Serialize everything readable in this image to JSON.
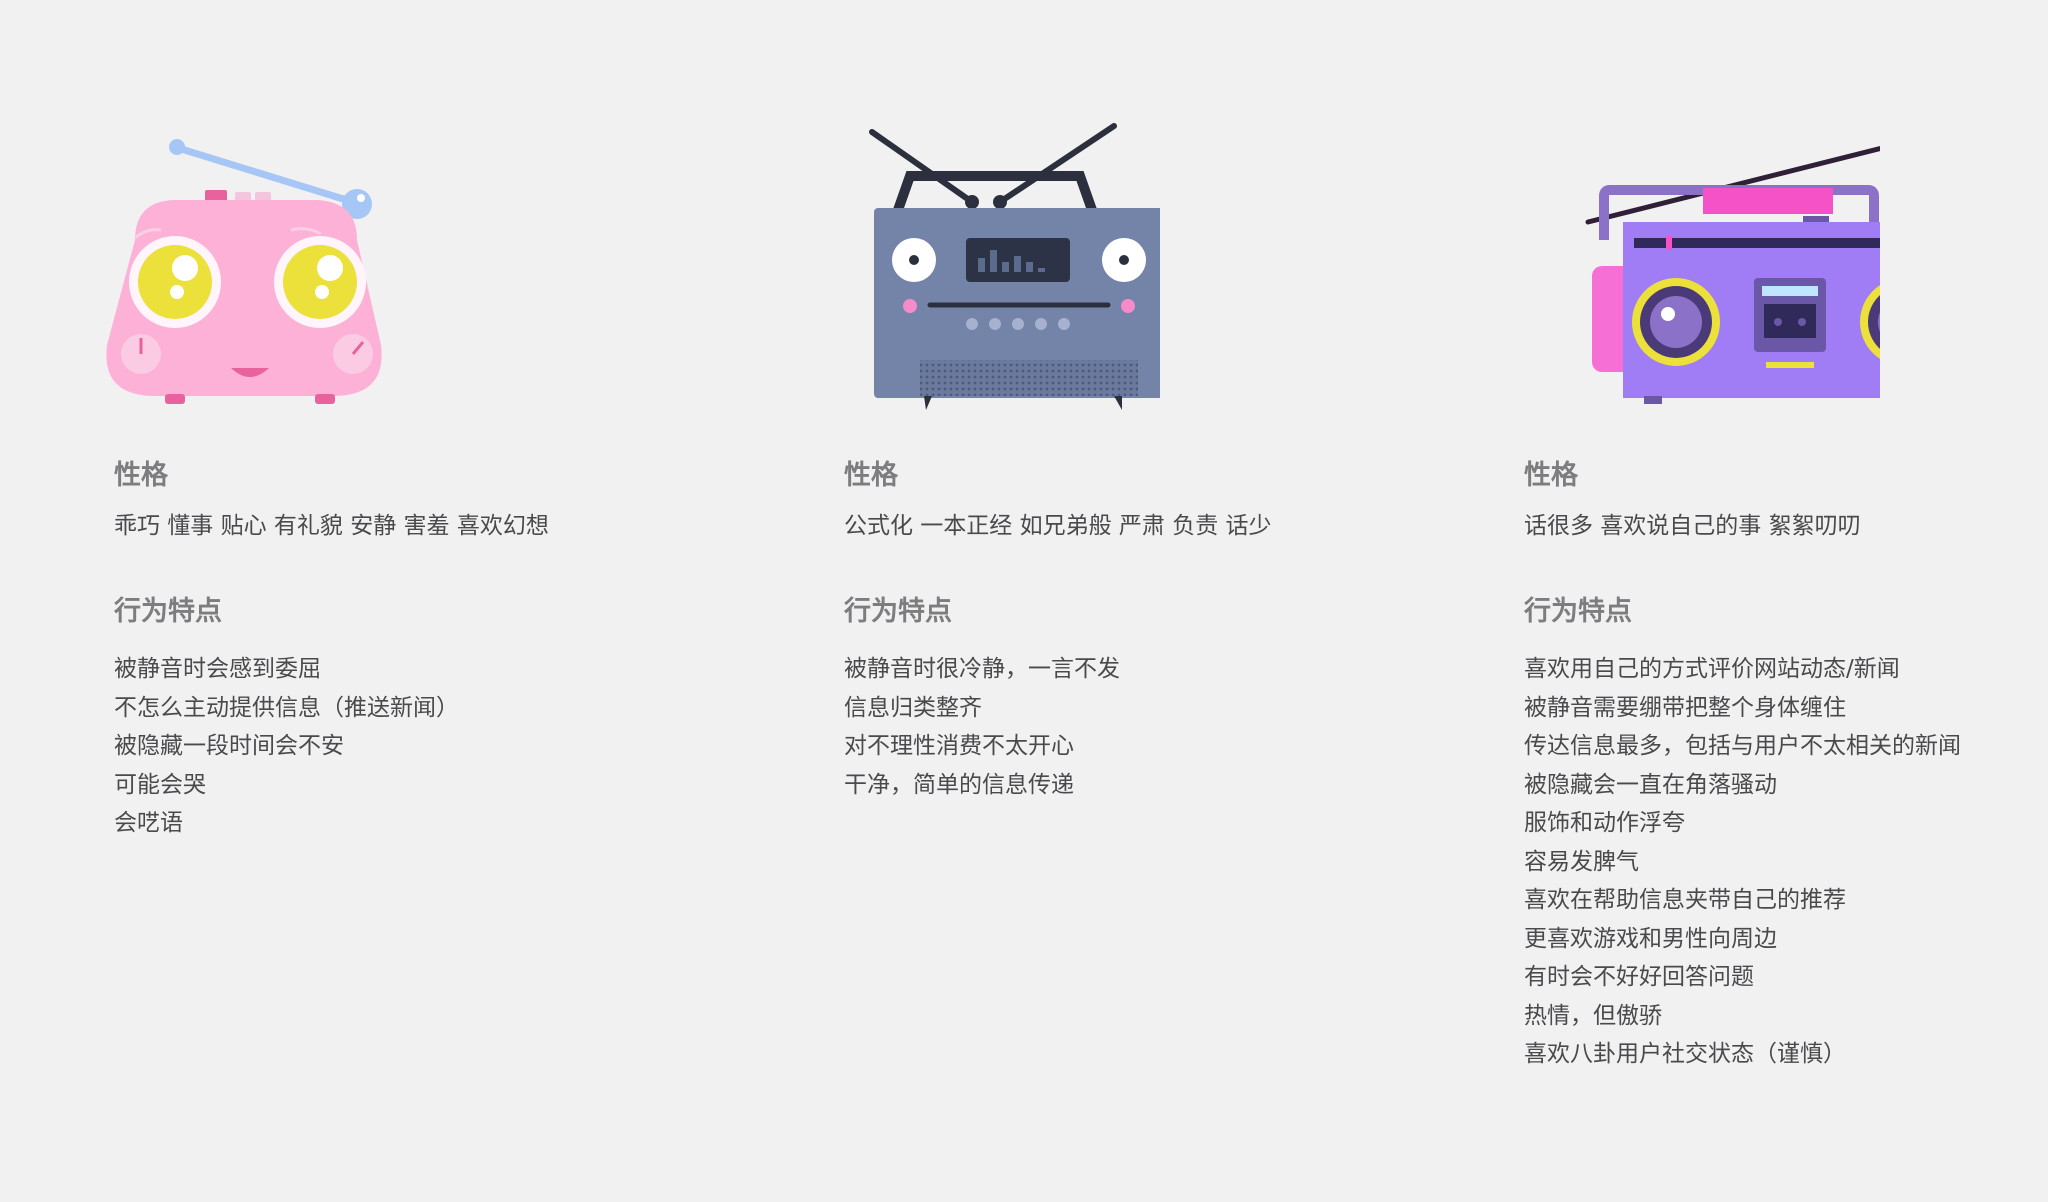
{
  "characters": [
    {
      "personality_heading": "性格",
      "personality": "乖巧 懂事 贴心 有礼貌 安静 害羞 喜欢幻想",
      "behavior_heading": "行为特点",
      "behaviors": [
        "被静音时会感到委屈",
        "不怎么主动提供信息（推送新闻）",
        "被隐藏一段时间会不安",
        "可能会哭",
        "会呓语"
      ]
    },
    {
      "personality_heading": "性格",
      "personality": "公式化 一本正经 如兄弟般 严肃 负责 话少",
      "behavior_heading": "行为特点",
      "behaviors": [
        "被静音时很冷静，一言不发",
        "信息归类整齐",
        "对不理性消费不太开心",
        "干净，简单的信息传递"
      ]
    },
    {
      "personality_heading": "性格",
      "personality": "话很多 喜欢说自己的事 絮絮叨叨",
      "behavior_heading": "行为特点",
      "behaviors": [
        "喜欢用自己的方式评价网站动态/新闻",
        "被静音需要绷带把整个身体缠住",
        "传达信息最多，包括与用户不太相关的新闻",
        "被隐藏会一直在角落骚动",
        "服饰和动作浮夸",
        "容易发脾气",
        "喜欢在帮助信息夹带自己的推荐",
        "更喜欢游戏和男性向周边",
        "有时会不好好回答问题",
        "热情，但傲骄",
        "喜欢八卦用户社交状态（谨慎）"
      ]
    }
  ],
  "colors": {
    "background": "#f2f1f2",
    "pink_radio": "#fdb1d6",
    "gray_radio": "#7484a8",
    "purple_boombox": "#a07cf5",
    "accent_yellow": "#ece03a",
    "accent_magenta": "#f552c8"
  }
}
